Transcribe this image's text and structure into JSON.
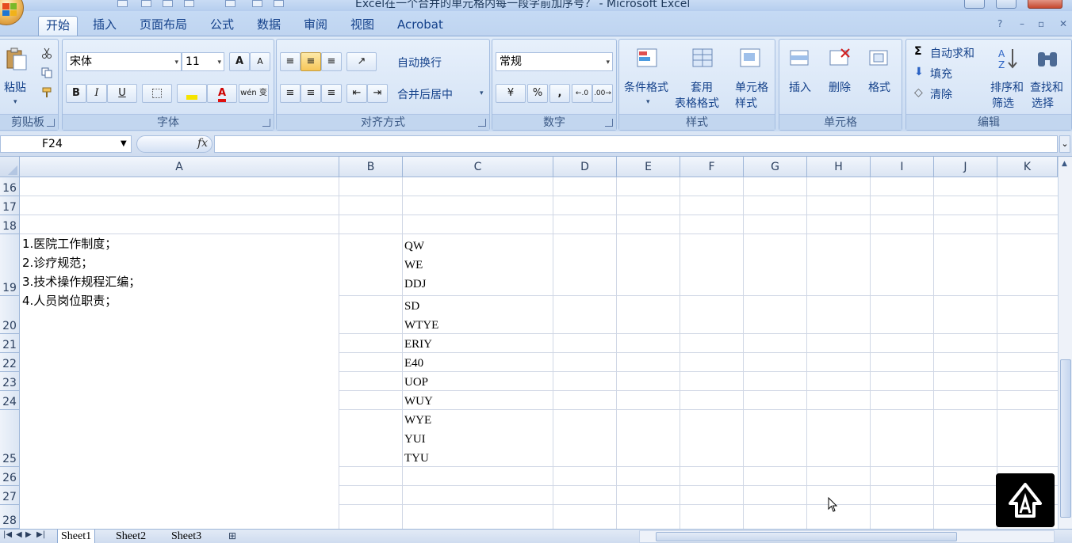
{
  "window": {
    "title": "Excel在一个合并的单元格内每一段字前加序号？ - Microsoft Excel"
  },
  "tabs": [
    {
      "label": "开始",
      "active": true
    },
    {
      "label": "插入"
    },
    {
      "label": "页面布局"
    },
    {
      "label": "公式"
    },
    {
      "label": "数据"
    },
    {
      "label": "审阅"
    },
    {
      "label": "视图"
    },
    {
      "label": "Acrobat"
    }
  ],
  "ribbon": {
    "clipboard": {
      "label": "剪贴板",
      "paste": "粘贴"
    },
    "font": {
      "label": "字体",
      "font_name": "宋体",
      "font_size": "11",
      "bold": "B",
      "italic": "I",
      "underline": "U",
      "phonetic": "wén 变",
      "grow": "A",
      "shrink": "A"
    },
    "alignment": {
      "label": "对齐方式",
      "wrap": "自动换行",
      "merge": "合并后居中"
    },
    "number": {
      "label": "数字",
      "format": "常规",
      "percent": "%",
      "comma": ","
    },
    "styles": {
      "label": "样式",
      "conditional": "条件格式",
      "table_l1": "套用",
      "table_l2": "表格格式",
      "cell_l1": "单元格",
      "cell_l2": "样式"
    },
    "cells": {
      "label": "单元格",
      "insert": "插入",
      "delete": "删除",
      "format": "格式"
    },
    "editing": {
      "label": "编辑",
      "autosum": "自动求和",
      "fill": "填充",
      "clear": "清除",
      "sort_l1": "排序和",
      "sort_l2": "筛选",
      "find_l1": "查找和",
      "find_l2": "选择"
    }
  },
  "formula_bar": {
    "name_box": "F24",
    "fx": "fx",
    "value": ""
  },
  "columns": [
    "A",
    "B",
    "C",
    "D",
    "E",
    "F",
    "G",
    "H",
    "I",
    "J",
    "K"
  ],
  "rows": [
    "16",
    "17",
    "18",
    "19",
    "20",
    "21",
    "22",
    "23",
    "24",
    "25",
    "26",
    "27",
    "28"
  ],
  "cells": {
    "A19": [
      "1.医院工作制度；",
      "2.诊疗规范；",
      "3.技术操作规程汇编；",
      "4.人员岗位职责；"
    ],
    "C19": [
      "QW",
      "WE",
      "DDJ"
    ],
    "C20": [
      "SD",
      "WTYE"
    ],
    "C21": "ERIY",
    "C22": "E40",
    "C23": "UOP",
    "C24": "WUY",
    "C25": [
      "WYE",
      "YUI",
      "TYU"
    ]
  },
  "sheets": [
    {
      "label": "Sheet1",
      "active": true
    },
    {
      "label": "Sheet2"
    },
    {
      "label": "Sheet3"
    }
  ],
  "colors": {
    "ribbon_text": "#15428b",
    "header_border": "#9eb6d8",
    "gridline": "#d0d7e5",
    "active_button": "#f6c658"
  }
}
